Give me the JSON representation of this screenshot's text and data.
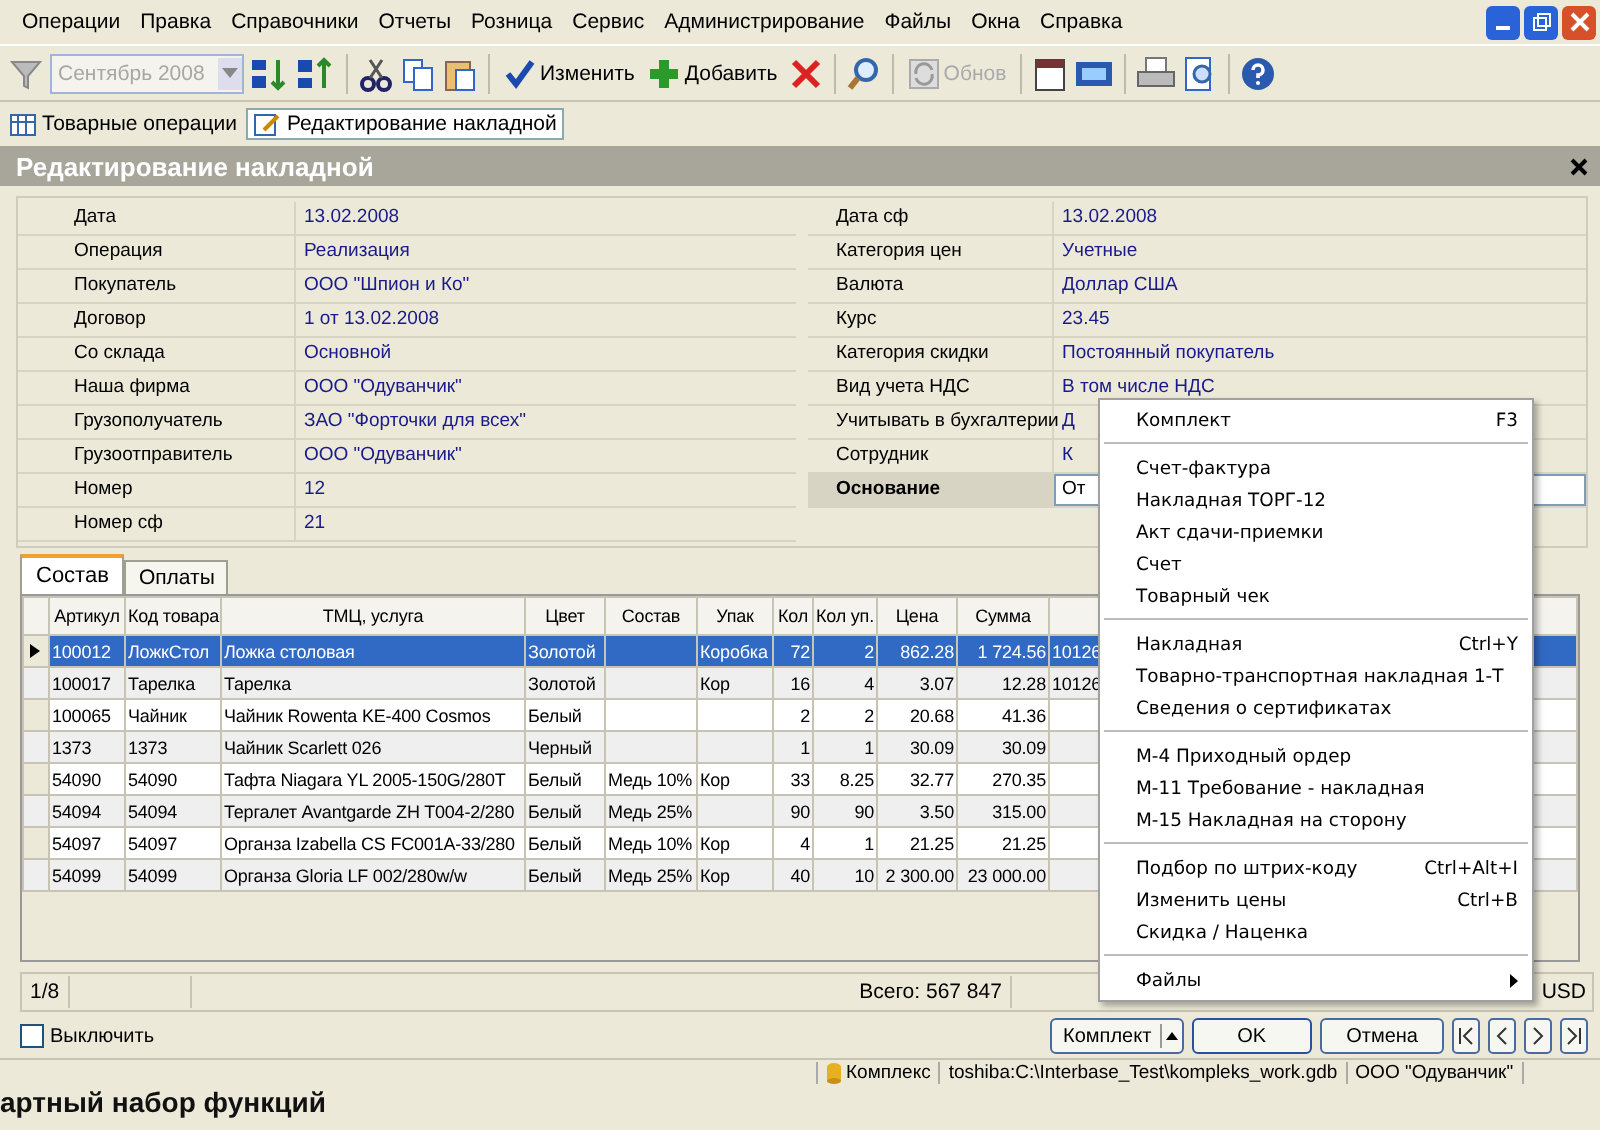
{
  "menu_bar": [
    "Операции",
    "Правка",
    "Справочники",
    "Отчеты",
    "Розница",
    "Сервис",
    "Администрирование",
    "Файлы",
    "Окна",
    "Справка"
  ],
  "toolbar": {
    "period_combo": {
      "value": "Сентябрь 2008",
      "disabled": true
    },
    "edit_button": "Изменить",
    "add_button": "Добавить",
    "refresh_button": {
      "label": "Обнов",
      "disabled": true
    }
  },
  "document_tabs": [
    {
      "label": "Товарные операции",
      "selected": false
    },
    {
      "label": "Редактирование накладной",
      "selected": true
    }
  ],
  "window": {
    "title": "Редактирование накладной"
  },
  "form_left": [
    {
      "label": "Дата",
      "value": "13.02.2008"
    },
    {
      "label": "Операция",
      "value": "Реализация"
    },
    {
      "label": "Покупатель",
      "value": "ООО \"Шпион и Ко\""
    },
    {
      "label": "Договор",
      "value": "1 от 13.02.2008"
    },
    {
      "label": "Со склада",
      "value": "Основной"
    },
    {
      "label": "Наша фирма",
      "value": "ООО \"Одуванчик\""
    },
    {
      "label": "Грузополучатель",
      "value": "ЗАО \"Форточки для всех\""
    },
    {
      "label": "Грузоотправитель",
      "value": "ООО \"Одуванчик\""
    },
    {
      "label": "Номер",
      "value": "12"
    },
    {
      "label": "Номер сф",
      "value": "21"
    }
  ],
  "form_right": [
    {
      "label": "Дата сф",
      "value": "13.02.2008",
      "kind": "text"
    },
    {
      "label": "Категория цен",
      "value": "Учетные",
      "kind": "text"
    },
    {
      "label": "Валюта",
      "value": "Доллар США",
      "kind": "text"
    },
    {
      "label": "Курс",
      "value": "23.45",
      "kind": "text"
    },
    {
      "label": "Категория скидки",
      "value": "Постоянный покупатель",
      "kind": "text"
    },
    {
      "label": "Вид учета НДС",
      "value": "В том числе НДС",
      "kind": "text"
    },
    {
      "label": "Учитывать в бухгалтерии",
      "value": "Д",
      "kind": "text"
    },
    {
      "label": "Сотрудник",
      "value": "К",
      "kind": "text"
    },
    {
      "label": "Основание",
      "value": "От",
      "kind": "dropdown"
    }
  ],
  "detail_tabs": [
    {
      "label": "Состав",
      "selected": true
    },
    {
      "label": "Оплаты",
      "selected": false
    }
  ],
  "table": {
    "columns": [
      "Артикул",
      "Код товара",
      "ТМЦ, услуга",
      "Цвет",
      "Состав",
      "Упак",
      "Кол",
      "Кол уп.",
      "Цена",
      "Сумма",
      ""
    ],
    "rows": [
      {
        "selected": true,
        "cells": [
          "100012",
          "ЛожкСтол",
          "Ложка столовая",
          "Золотой",
          "",
          "Коробка",
          "72",
          "2",
          "862.28",
          "1 724.56",
          "10126"
        ]
      },
      {
        "selected": false,
        "cells": [
          "100017",
          "Тарелка",
          "Тарелка",
          "Золотой",
          "",
          "Кор",
          "16",
          "4",
          "3.07",
          "12.28",
          "10126"
        ]
      },
      {
        "selected": false,
        "cells": [
          "100065",
          "Чайник",
          "Чайник  Rowenta KE-400 Cosmos",
          "Белый",
          "",
          "",
          "2",
          "2",
          "20.68",
          "41.36",
          ""
        ]
      },
      {
        "selected": false,
        "cells": [
          "1373",
          "1373",
          "Чайник  Scarlett 026",
          "Черный",
          "",
          "",
          "1",
          "1",
          "30.09",
          "30.09",
          ""
        ]
      },
      {
        "selected": false,
        "cells": [
          "54090",
          "54090",
          "Тафта Niagara YL 2005-150G/280T",
          "Белый",
          "Медь 10%",
          "Кор",
          "33",
          "8.25",
          "32.77",
          "270.35",
          ""
        ]
      },
      {
        "selected": false,
        "cells": [
          "54094",
          "54094",
          "Тергалет Avantgarde ZH T004-2/280",
          "Белый",
          "Медь 25%",
          "",
          "90",
          "90",
          "3.50",
          "315.00",
          ""
        ]
      },
      {
        "selected": false,
        "cells": [
          "54097",
          "54097",
          "Органза Izabella CS FC001A-33/280",
          "Белый",
          "Медь 10%",
          "Кор",
          "4",
          "1",
          "21.25",
          "21.25",
          ""
        ]
      },
      {
        "selected": false,
        "cells": [
          "54099",
          "54099",
          "Органза Gloria LF 002/280w/w",
          "Белый",
          "Медь 25%",
          "Кор",
          "40",
          "10",
          "2 300.00",
          "23 000.00",
          ""
        ]
      }
    ]
  },
  "footer": {
    "position": "1/8",
    "total": "Всего: 567 847",
    "currency": "USD"
  },
  "disable_checkbox": {
    "label": "Выключить",
    "checked": false
  },
  "buttons": {
    "kit": "Комплект",
    "ok": "OK",
    "cancel": "Отмена"
  },
  "context_menu": [
    {
      "kind": "item",
      "label": "Комплект",
      "shortcut": "F3"
    },
    {
      "kind": "separator"
    },
    {
      "kind": "item",
      "label": "Счет-фактура"
    },
    {
      "kind": "item",
      "label": "Накладная ТОРГ-12"
    },
    {
      "kind": "item",
      "label": "Акт сдачи-приемки"
    },
    {
      "kind": "item",
      "label": "Счет"
    },
    {
      "kind": "item",
      "label": "Товарный чек"
    },
    {
      "kind": "separator"
    },
    {
      "kind": "item",
      "label": "Накладная",
      "shortcut": "Ctrl+Y"
    },
    {
      "kind": "item",
      "label": "Товарно-транспортная накладная 1-Т"
    },
    {
      "kind": "item",
      "label": "Сведения о сертификатах"
    },
    {
      "kind": "separator"
    },
    {
      "kind": "item",
      "label": "М-4 Приходный ордер"
    },
    {
      "kind": "item",
      "label": "М-11 Требование - накладная"
    },
    {
      "kind": "item",
      "label": "М-15 Накладная на сторону"
    },
    {
      "kind": "separator"
    },
    {
      "kind": "item",
      "label": "Подбор по штрих-коду",
      "shortcut": "Ctrl+Alt+I"
    },
    {
      "kind": "item",
      "label": "Изменить цены",
      "shortcut": "Ctrl+B"
    },
    {
      "kind": "item",
      "label": "Скидка / Наценка"
    },
    {
      "kind": "separator"
    },
    {
      "kind": "submenu",
      "label": "Файлы"
    }
  ],
  "status_bar": {
    "program": "Комплекс",
    "database": "toshiba:C:\\Interbase_Test\\kompleks_work.gdb",
    "company": "ООО \"Одуванчик\""
  },
  "caption": "артный набор функций"
}
